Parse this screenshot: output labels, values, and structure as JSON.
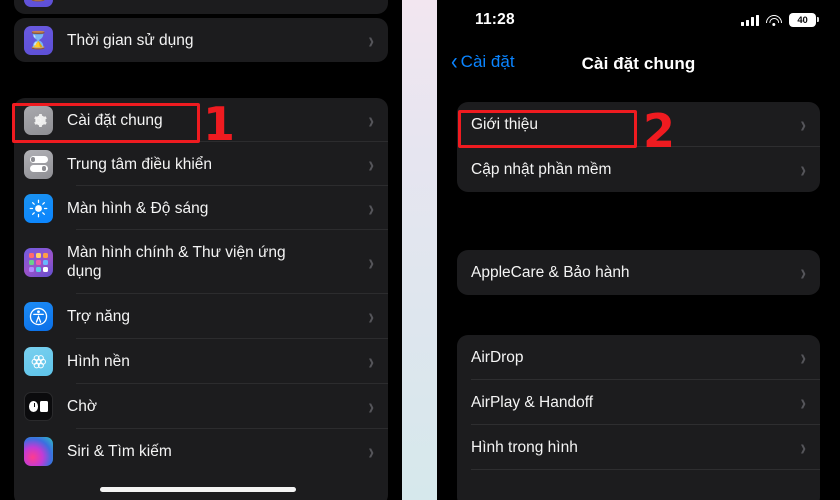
{
  "left_screen": {
    "name": "settings-list-screen",
    "partial_top_item": {
      "label": "",
      "icon": "hourglass-icon"
    },
    "groups": [
      {
        "id": "group-screentime",
        "items": [
          {
            "label": "Thời gian sử dụng",
            "icon": "hourglass-icon",
            "chevron": "›"
          }
        ]
      },
      {
        "id": "group-general",
        "items": [
          {
            "label": "Cài đặt chung",
            "icon": "gear-icon",
            "chevron": "›"
          },
          {
            "label": "Trung tâm điều khiển",
            "icon": "control-center-icon",
            "chevron": "›"
          },
          {
            "label": "Màn hình & Độ sáng",
            "icon": "brightness-icon",
            "chevron": "›"
          },
          {
            "label": "Màn hình chính & Thư viện ứng dụng",
            "icon": "home-screen-icon",
            "chevron": "›"
          },
          {
            "label": "Trợ năng",
            "icon": "accessibility-icon",
            "chevron": "›"
          },
          {
            "label": "Hình nền",
            "icon": "wallpaper-icon",
            "chevron": "›"
          },
          {
            "label": "Chờ",
            "icon": "standby-icon",
            "chevron": "›"
          },
          {
            "label": "Siri & Tìm kiếm",
            "icon": "siri-icon",
            "chevron": "›"
          }
        ]
      }
    ]
  },
  "right_screen": {
    "name": "general-settings-screen",
    "status_bar": {
      "time": "11:28",
      "signal_icon": "cellular-signal-icon",
      "wifi_icon": "wifi-icon",
      "battery_level": "40"
    },
    "nav": {
      "back_chevron": "‹",
      "back_label": "Cài đặt",
      "title": "Cài đặt chung"
    },
    "groups": [
      {
        "id": "group-about",
        "items": [
          {
            "label": "Giới thiệu",
            "chevron": "›"
          },
          {
            "label": "Cập nhật phần mềm",
            "chevron": "›"
          }
        ]
      },
      {
        "id": "group-applecare",
        "items": [
          {
            "label": "AppleCare & Bảo hành",
            "chevron": "›"
          }
        ]
      },
      {
        "id": "group-sharing",
        "items": [
          {
            "label": "AirDrop",
            "chevron": "›"
          },
          {
            "label": "AirPlay & Handoff",
            "chevron": "›"
          },
          {
            "label": "Hình trong hình",
            "chevron": "›"
          }
        ]
      }
    ]
  },
  "annotations": {
    "color": "#ef1b20",
    "steps": [
      {
        "number": "1",
        "target": "Cài đặt chung"
      },
      {
        "number": "2",
        "target": "Giới thiệu"
      }
    ]
  }
}
